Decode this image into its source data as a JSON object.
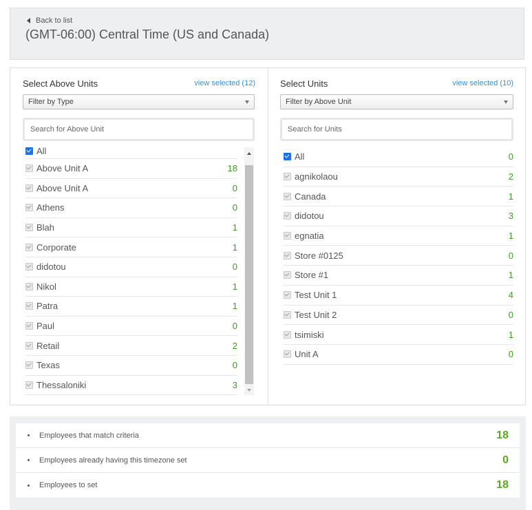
{
  "header": {
    "back_label": "Back to list",
    "title": "(GMT-06:00) Central Time (US and Canada)"
  },
  "left": {
    "title": "Select Above Units",
    "view_selected": "view selected (12)",
    "filter": "Filter by Type",
    "search_placeholder": "Search for Above Unit",
    "items": [
      {
        "label": "All",
        "count": ""
      },
      {
        "label": "Above Unit A",
        "count": "18"
      },
      {
        "label": "Above Unit A",
        "count": "0"
      },
      {
        "label": "Athens",
        "count": "0"
      },
      {
        "label": "Blah",
        "count": "1"
      },
      {
        "label": "Corporate",
        "count": "1"
      },
      {
        "label": "didotou",
        "count": "0"
      },
      {
        "label": "Nikol",
        "count": "1"
      },
      {
        "label": "Patra",
        "count": "1"
      },
      {
        "label": "Paul",
        "count": "0"
      },
      {
        "label": "Retail",
        "count": "2"
      },
      {
        "label": "Texas",
        "count": "0"
      },
      {
        "label": "Thessaloniki",
        "count": "3"
      }
    ]
  },
  "right": {
    "title": "Select Units",
    "view_selected": "view selected (10)",
    "filter": "Filter by Above Unit",
    "search_placeholder": "Search for Units",
    "items": [
      {
        "label": "All",
        "count": "0"
      },
      {
        "label": "agnikolaou",
        "count": "2"
      },
      {
        "label": "Canada",
        "count": "1"
      },
      {
        "label": "didotou",
        "count": "3"
      },
      {
        "label": "egnatia",
        "count": "1"
      },
      {
        "label": "Store #0125",
        "count": "0"
      },
      {
        "label": "Store #1",
        "count": "1"
      },
      {
        "label": "Test Unit 1",
        "count": "4"
      },
      {
        "label": "Test Unit 2",
        "count": "0"
      },
      {
        "label": "tsimiski",
        "count": "1"
      },
      {
        "label": "Unit A",
        "count": "0"
      }
    ]
  },
  "summary": [
    {
      "label": "Employees that match criteria",
      "value": "18"
    },
    {
      "label": "Employees already having this timezone set",
      "value": "0"
    },
    {
      "label": "Employees to set",
      "value": "18"
    }
  ],
  "colors": {
    "accent_link": "#3a8fc9",
    "count_green": "#3c9a1f",
    "summary_green": "#5aa623",
    "checkbox_blue": "#1a73e8"
  }
}
